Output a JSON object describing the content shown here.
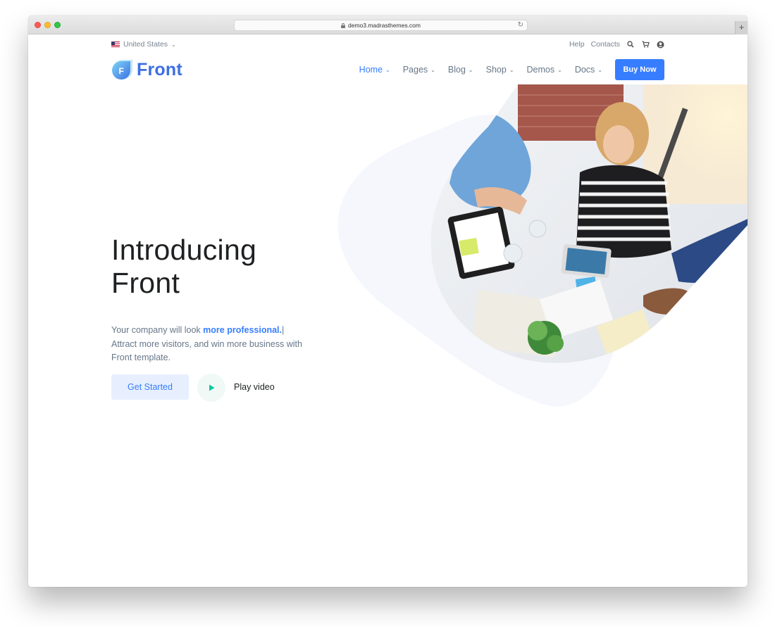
{
  "browser": {
    "url": "demo3.madrasthemes.com"
  },
  "topbar": {
    "locale": "United States",
    "help": "Help",
    "contacts": "Contacts"
  },
  "brand": {
    "name": "Front",
    "mark_letter": "F",
    "color": "#3d6fe3"
  },
  "nav": {
    "items": [
      {
        "label": "Home",
        "active": true
      },
      {
        "label": "Pages"
      },
      {
        "label": "Blog"
      },
      {
        "label": "Shop"
      },
      {
        "label": "Demos"
      },
      {
        "label": "Docs"
      }
    ],
    "cta": "Buy Now"
  },
  "hero": {
    "title_line1": "Introducing",
    "title_line2": "Front",
    "desc_prefix": "Your company will look ",
    "desc_emphasis": "more professional.",
    "desc_cursor": "|",
    "desc_rest": "Attract more visitors, and win more business with Front template.",
    "cta_primary": "Get Started",
    "video_label": "Play video"
  },
  "colors": {
    "accent": "#377dff",
    "accent_soft": "#e7efff",
    "play_green": "#00c9a7",
    "text_dark": "#1e2022",
    "text_muted": "#677788"
  },
  "icons": [
    "search-icon",
    "cart-icon",
    "user-icon",
    "play-icon",
    "lock-icon",
    "reload-icon"
  ]
}
